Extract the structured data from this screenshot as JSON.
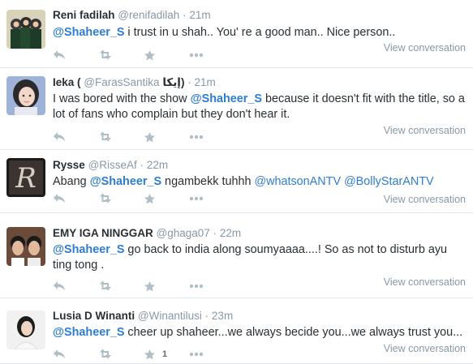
{
  "tweets": [
    {
      "fullname": "Reni fadilah",
      "username": "@renifadilah",
      "separator": "·",
      "time": "21m",
      "parts": [
        {
          "type": "mention",
          "text": "@Shaheer_S"
        },
        {
          "type": "text",
          "text": " i trust in u shah.. You' re a good man.. Nice person.."
        }
      ],
      "favorite_count": "",
      "view_label": "View conversation"
    },
    {
      "fullname": "Ieka (",
      "username": "@FarasSantika",
      "name_suffix": "إيكا)",
      "separator": "·",
      "time": "21m",
      "parts": [
        {
          "type": "text",
          "text": "I was bored with the show "
        },
        {
          "type": "mention",
          "text": "@Shaheer_S"
        },
        {
          "type": "text",
          "text": "  because it doesn't fit with the title, so a lot of fans who complain but they don't hear it."
        }
      ],
      "favorite_count": "",
      "view_label": "View conversation"
    },
    {
      "fullname": "Rysse",
      "username": "@RisseAf",
      "separator": "·",
      "time": "22m",
      "parts": [
        {
          "type": "text",
          "text": "Abang "
        },
        {
          "type": "mention",
          "text": "@Shaheer_S"
        },
        {
          "type": "text",
          "text": "  ngambekk tuhhh "
        },
        {
          "type": "link",
          "text": "@whatsonANTV"
        },
        {
          "type": "text",
          "text": " "
        },
        {
          "type": "link",
          "text": "@BollyStarANTV"
        }
      ],
      "favorite_count": "",
      "view_label": "View conversation"
    },
    {
      "fullname": "EMY IGA NINGGAR",
      "username": "@ghaga07",
      "separator": "·",
      "time": "22m",
      "parts": [
        {
          "type": "mention",
          "text": "@Shaheer_S"
        },
        {
          "type": "text",
          "text": " go back to india along soumyaaaa....! So as not to disturb ayu ting tong ."
        }
      ],
      "favorite_count": "",
      "view_label": "View conversation"
    },
    {
      "fullname": "Lusia D Winanti",
      "username": "@Winantilusi",
      "separator": "·",
      "time": "23m",
      "parts": [
        {
          "type": "mention",
          "text": "@Shaheer_S"
        },
        {
          "type": "text",
          "text": " cheer up shaheer...we always becide you...we always trust you..."
        }
      ],
      "favorite_count": "1",
      "view_label": "View conversation"
    }
  ],
  "icons": {
    "reply": "reply-icon",
    "retweet": "retweet-icon",
    "favorite": "star-icon",
    "more": "more-icon"
  },
  "colors": {
    "mention": "#2e7dd1",
    "meta": "#8899a6",
    "action_icon": "#b0bec5",
    "divider": "#e1e8ed"
  }
}
